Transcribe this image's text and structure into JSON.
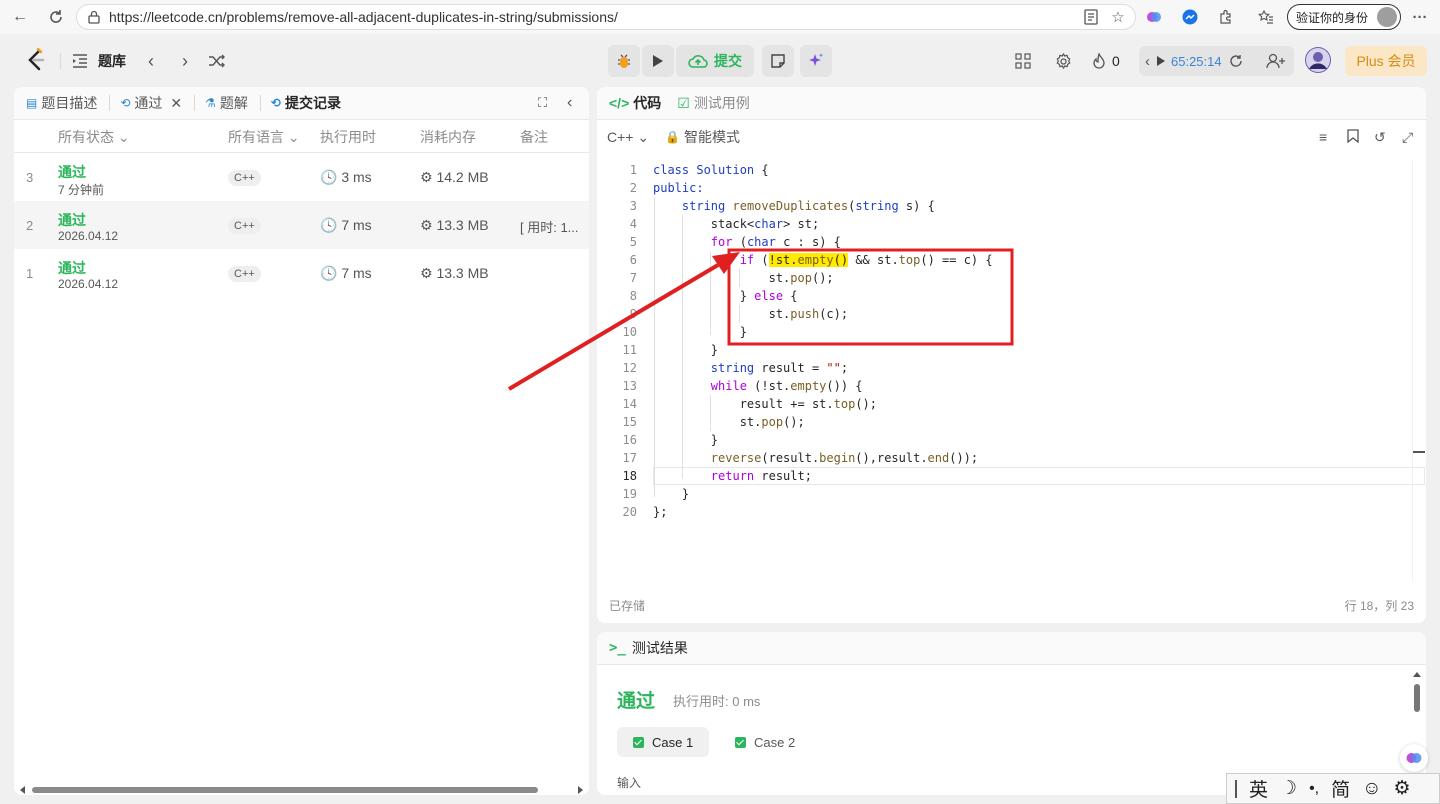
{
  "browser": {
    "url": "https://leetcode.cn/problems/remove-all-adjacent-duplicates-in-string/submissions/",
    "verify_label": "验证你的身份"
  },
  "header": {
    "problem_bank": "题库",
    "submit": "提交",
    "streak": "0",
    "timer": "65:25:14",
    "plus": "Plus 会员"
  },
  "left_tabs": {
    "description": "题目描述",
    "passed": "通过",
    "solutions": "题解",
    "submissions": "提交记录"
  },
  "columns": {
    "status": "所有状态",
    "language": "所有语言",
    "runtime": "执行用时",
    "memory": "消耗内存",
    "notes": "备注"
  },
  "submissions": [
    {
      "index": "3",
      "status": "通过",
      "date": "7 分钟前",
      "lang": "C++",
      "runtime": "3 ms",
      "memory": "14.2 MB",
      "note": ""
    },
    {
      "index": "2",
      "status": "通过",
      "date": "2026.04.12",
      "lang": "C++",
      "runtime": "7 ms",
      "memory": "13.3 MB",
      "note": "[ 用时: 1..."
    },
    {
      "index": "1",
      "status": "通过",
      "date": "2026.04.12",
      "lang": "C++",
      "runtime": "7 ms",
      "memory": "13.3 MB",
      "note": ""
    }
  ],
  "code_tabs": {
    "code": "代码",
    "testcase": "测试用例"
  },
  "code_toolbar": {
    "language": "C++",
    "mode": "智能模式"
  },
  "code_lines": [
    "class Solution {",
    "public:",
    "    string removeDuplicates(string s) {",
    "        stack<char> st;",
    "        for (char c : s) {",
    "            if (!st.empty() && st.top() == c) {",
    "                st.pop();",
    "            } else {",
    "                st.push(c);",
    "            }",
    "        }",
    "        string result = \"\";",
    "        while (!st.empty()) {",
    "            result += st.top();",
    "            st.pop();",
    "        }",
    "        reverse(result.begin(),result.end());",
    "        return result;",
    "    }",
    "};"
  ],
  "code_footer": {
    "saved": "已存储",
    "position": "行 18，列 23"
  },
  "result": {
    "title": "测试结果",
    "status": "通过",
    "runtime": "执行用时: 0 ms",
    "case1": "Case 1",
    "case2": "Case 2",
    "input_label": "输入"
  },
  "ime": {
    "lang": "英",
    "punct": "•,",
    "script": "简"
  },
  "colors": {
    "accept_green": "#2db55d",
    "annotation_red": "#e02020",
    "highlight_yellow": "#ffea00"
  }
}
